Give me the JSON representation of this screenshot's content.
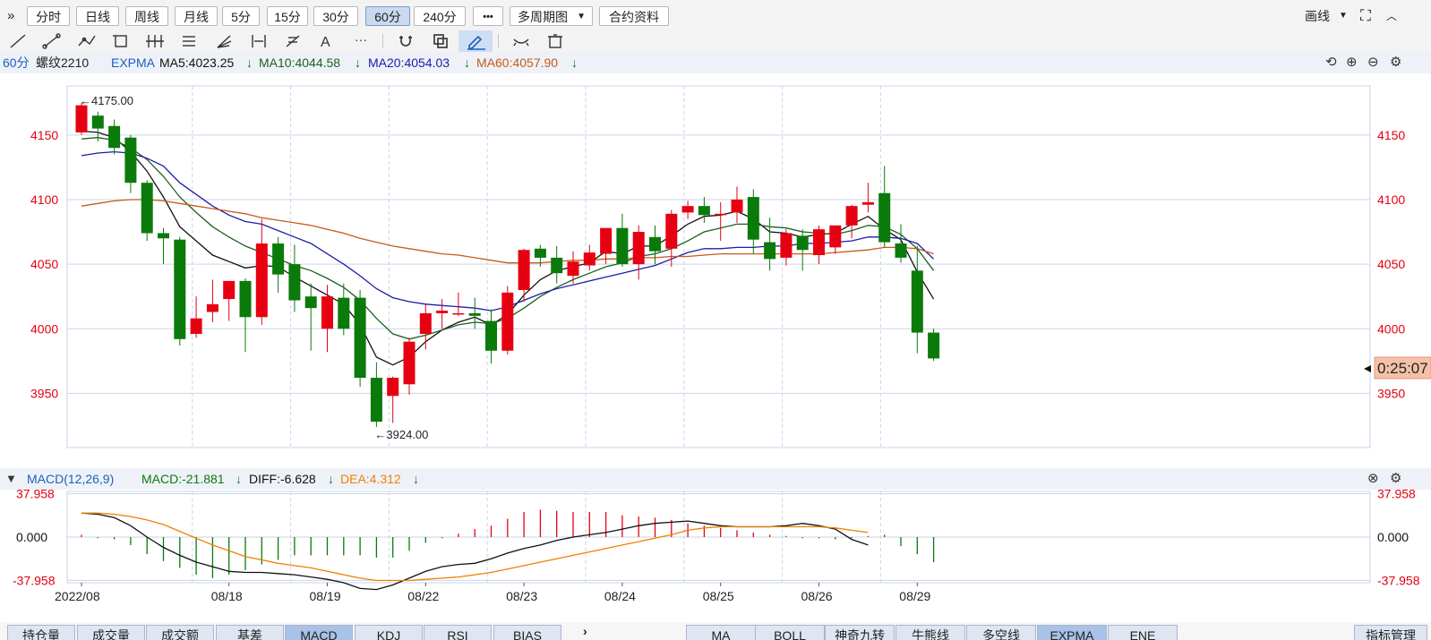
{
  "toolbar": {
    "expand_glyph": "»",
    "periods": [
      {
        "label": "分时",
        "active": false
      },
      {
        "label": "日线",
        "active": false
      },
      {
        "label": "周线",
        "active": false
      },
      {
        "label": "月线",
        "active": false
      },
      {
        "label": "5分",
        "active": false
      },
      {
        "label": "15分",
        "active": false
      },
      {
        "label": "30分",
        "active": false
      },
      {
        "label": "60分",
        "active": true
      },
      {
        "label": "240分",
        "active": false
      }
    ],
    "more": "•••",
    "multi_period": "多周期图",
    "contract_info": "合约资料",
    "draw": "画线",
    "fullscreen_glyph": "⛶"
  },
  "drawing_tools": [
    "line-icon",
    "ray-icon",
    "polyline-icon",
    "rectangle-tool-icon",
    "parallel-channel-icon",
    "fibonacci-icon",
    "fan-icon",
    "measure-icon",
    "gann-icon",
    "text-tool-icon",
    "more-tools-icon",
    "magnet-icon",
    "copy-icon",
    "pencil-icon",
    "hide-icon",
    "trash-icon"
  ],
  "info": {
    "period": "60分",
    "symbol": "螺纹2210",
    "indicator": "EXPMA",
    "ma5": "MA5:4023.25",
    "ma10": "MA10:4044.58",
    "ma20": "MA20:4054.03",
    "ma60": "MA60:4057.90",
    "down_arrow": "↓"
  },
  "macd_info": {
    "name": "MACD(12,26,9)",
    "macd": "MACD:-21.881",
    "diff": "DIFF:-6.628",
    "dea": "DEA:4.312",
    "down_arrow": "↓"
  },
  "countdown": "0:25:07",
  "bottom_tabs_left": [
    {
      "label": "持仓量",
      "active": false
    },
    {
      "label": "成交量",
      "active": false
    },
    {
      "label": "成交额",
      "active": false
    },
    {
      "label": "基差",
      "active": false
    },
    {
      "label": "MACD",
      "active": true
    },
    {
      "label": "KDJ",
      "active": false
    },
    {
      "label": "RSI",
      "active": false
    },
    {
      "label": "BIAS",
      "active": false
    }
  ],
  "bottom_tabs_right": [
    {
      "label": "MA",
      "active": false
    },
    {
      "label": "BOLL",
      "active": false
    },
    {
      "label": "神奇九转",
      "active": false
    },
    {
      "label": "牛熊线",
      "active": false
    },
    {
      "label": "多空线",
      "active": false
    },
    {
      "label": "EXPMA",
      "active": true
    },
    {
      "label": "ENE",
      "active": false
    }
  ],
  "indicator_manage": "指标管理",
  "colors": {
    "up": "#e60012",
    "down": "#0a7a0a",
    "ma5": "#111111",
    "ma10": "#1f5f1f",
    "ma20": "#1c1ca8",
    "ma60": "#c85a1a",
    "dea": "#f08000",
    "axis_red": "#e60012",
    "grid": "#c9d6ea"
  },
  "chart_data": [
    {
      "type": "candlestick",
      "ylim": [
        3908,
        4188
      ],
      "yticks": [
        4150,
        4100,
        4050,
        4000,
        3950
      ],
      "ytick_labels": [
        "4150",
        "4100",
        "4050",
        "4000",
        "3950"
      ],
      "annotations": [
        {
          "text": "←4175.00",
          "value": 4175,
          "bar": 0
        },
        {
          "text": "←3924.00",
          "value": 3924,
          "bar": 18
        }
      ],
      "x_labels": [
        {
          "text": "2022/08",
          "bar": 0
        },
        {
          "text": "08/18",
          "bar": 9
        },
        {
          "text": "08/19",
          "bar": 15
        },
        {
          "text": "08/22",
          "bar": 21
        },
        {
          "text": "08/23",
          "bar": 27
        },
        {
          "text": "08/24",
          "bar": 33
        },
        {
          "text": "08/25",
          "bar": 39
        },
        {
          "text": "08/26",
          "bar": 45
        },
        {
          "text": "08/29",
          "bar": 51
        }
      ],
      "ohlc": [
        [
          4152,
          4175,
          4150,
          4173
        ],
        [
          4165,
          4168,
          4145,
          4155
        ],
        [
          4157,
          4162,
          4135,
          4140
        ],
        [
          4148,
          4150,
          4105,
          4113
        ],
        [
          4113,
          4115,
          4068,
          4074
        ],
        [
          4074,
          4078,
          4050,
          4070
        ],
        [
          4069,
          4071,
          3987,
          3992
        ],
        [
          3996,
          4025,
          3993,
          4008
        ],
        [
          4013,
          4038,
          4005,
          4019
        ],
        [
          4023,
          4035,
          4006,
          4037
        ],
        [
          4037,
          4039,
          3982,
          4009
        ],
        [
          4009,
          4085,
          4003,
          4066
        ],
        [
          4066,
          4071,
          4028,
          4042
        ],
        [
          4050,
          4065,
          4013,
          4022
        ],
        [
          4025,
          4035,
          3983,
          4016
        ],
        [
          4000,
          4034,
          3982,
          4025
        ],
        [
          4024,
          4035,
          3995,
          4000
        ],
        [
          4024,
          4030,
          3955,
          3962
        ],
        [
          3962,
          3974,
          3924,
          3928
        ],
        [
          3948,
          3963,
          3927,
          3962
        ],
        [
          3957,
          3993,
          3949,
          3990
        ],
        [
          3996,
          4019,
          3984,
          4012
        ],
        [
          4012,
          4023,
          4000,
          4014
        ],
        [
          4012,
          4028,
          4010,
          4012
        ],
        [
          4012,
          4024,
          4000,
          4010
        ],
        [
          4006,
          4015,
          3973,
          3983
        ],
        [
          3983,
          4033,
          3980,
          4028
        ],
        [
          4030,
          4062,
          4021,
          4061
        ],
        [
          4062,
          4065,
          4048,
          4055
        ],
        [
          4055,
          4064,
          4035,
          4043
        ],
        [
          4041,
          4060,
          4035,
          4052
        ],
        [
          4049,
          4065,
          4045,
          4059
        ],
        [
          4058,
          4072,
          4050,
          4078
        ],
        [
          4078,
          4089,
          4048,
          4050
        ],
        [
          4050,
          4080,
          4038,
          4075
        ],
        [
          4071,
          4080,
          4050,
          4060
        ],
        [
          4062,
          4092,
          4048,
          4089
        ],
        [
          4090,
          4099,
          4085,
          4095
        ],
        [
          4095,
          4102,
          4082,
          4088
        ],
        [
          4089,
          4098,
          4068,
          4089
        ],
        [
          4090,
          4110,
          4082,
          4100
        ],
        [
          4102,
          4108,
          4058,
          4069
        ],
        [
          4067,
          4086,
          4045,
          4054
        ],
        [
          4055,
          4077,
          4049,
          4074
        ],
        [
          4072,
          4077,
          4045,
          4061
        ],
        [
          4057,
          4080,
          4050,
          4077
        ],
        [
          4063,
          4072,
          4058,
          4080
        ],
        [
          4080,
          4096,
          4070,
          4095
        ],
        [
          4096,
          4113,
          4090,
          4098
        ],
        [
          4105,
          4126,
          4063,
          4067
        ],
        [
          4066,
          4081,
          4051,
          4055
        ],
        [
          4045,
          4064,
          3981,
          3997
        ],
        [
          3997,
          4000,
          3975,
          3977
        ]
      ],
      "series": [
        {
          "name": "MA5",
          "values": [
            4153,
            4152,
            4148,
            4137,
            4122,
            4102,
            4079,
            4068,
            4057,
            4052,
            4047,
            4049,
            4048,
            4040,
            4033,
            4026,
            4019,
            4003,
            3978,
            3972,
            3978,
            3990,
            3999,
            4005,
            4009,
            4003,
            4011,
            4026,
            4038,
            4045,
            4048,
            4051,
            4060,
            4058,
            4064,
            4064,
            4072,
            4081,
            4087,
            4088,
            4091,
            4085,
            4075,
            4074,
            4071,
            4073,
            4074,
            4081,
            4087,
            4077,
            4069,
            4044,
            4023
          ]
        },
        {
          "name": "MA10",
          "values": [
            4147,
            4148,
            4146,
            4140,
            4131,
            4118,
            4102,
            4090,
            4079,
            4071,
            4064,
            4059,
            4054,
            4049,
            4045,
            4039,
            4032,
            4022,
            4008,
            3996,
            3992,
            3995,
            3999,
            4003,
            4005,
            4004,
            4008,
            4016,
            4025,
            4032,
            4038,
            4043,
            4048,
            4051,
            4056,
            4058,
            4062,
            4068,
            4075,
            4078,
            4081,
            4081,
            4079,
            4078,
            4075,
            4074,
            4073,
            4076,
            4080,
            4079,
            4073,
            4062,
            4045
          ]
        },
        {
          "name": "MA20",
          "values": [
            4134,
            4136,
            4137,
            4136,
            4132,
            4126,
            4113,
            4104,
            4095,
            4088,
            4083,
            4081,
            4076,
            4071,
            4066,
            4058,
            4050,
            4041,
            4031,
            4024,
            4021,
            4019,
            4018,
            4017,
            4016,
            4014,
            4017,
            4022,
            4027,
            4031,
            4034,
            4037,
            4040,
            4043,
            4046,
            4049,
            4054,
            4059,
            4062,
            4062,
            4063,
            4063,
            4064,
            4064,
            4066,
            4066,
            4067,
            4068,
            4071,
            4071,
            4070,
            4066,
            4054
          ]
        },
        {
          "name": "MA60",
          "values": [
            4095,
            4097,
            4099,
            4100,
            4100,
            4099,
            4097,
            4095,
            4093,
            4091,
            4089,
            4086,
            4084,
            4082,
            4080,
            4077,
            4074,
            4070,
            4067,
            4064,
            4062,
            4060,
            4058,
            4057,
            4055,
            4053,
            4051,
            4051,
            4051,
            4052,
            4053,
            4053,
            4054,
            4054,
            4055,
            4055,
            4056,
            4056,
            4057,
            4058,
            4058,
            4058,
            4058,
            4058,
            4058,
            4058,
            4059,
            4060,
            4061,
            4063,
            4063,
            4062,
            4058
          ]
        }
      ]
    },
    {
      "type": "macd",
      "ylim": [
        -40,
        40
      ],
      "yticks": [
        37.958,
        0,
        -37.958
      ],
      "ytick_labels": [
        "37.958",
        "0.000",
        "-37.958"
      ],
      "histogram": [
        2,
        -1,
        -2,
        -7,
        -15,
        -21,
        -27,
        -33,
        -36,
        -33,
        -29,
        -24,
        -20,
        -16,
        -16,
        -16,
        -16,
        -16,
        -18,
        -18,
        -12,
        -5,
        -1,
        3,
        7,
        10,
        16,
        22,
        24,
        23,
        22,
        22,
        22,
        19,
        18,
        17,
        15,
        12,
        10,
        8,
        6,
        4,
        2,
        1,
        -1,
        -1,
        -2,
        -1,
        1,
        2,
        -8,
        -15,
        -22
      ],
      "series": [
        {
          "name": "DIFF",
          "values": [
            21,
            20,
            17,
            10,
            0,
            -9,
            -16,
            -22,
            -26,
            -30,
            -31,
            -31,
            -32,
            -33,
            -35,
            -37,
            -40,
            -45,
            -46,
            -42,
            -36,
            -30,
            -26,
            -24,
            -23,
            -19,
            -14,
            -10,
            -7,
            -3,
            0,
            2,
            4,
            7,
            10,
            12,
            13,
            14,
            12,
            10,
            9,
            9,
            9,
            10,
            12,
            10,
            7,
            -2,
            -7
          ]
        },
        {
          "name": "DEA",
          "values": [
            21,
            21,
            20,
            18,
            15,
            11,
            5,
            -1,
            -7,
            -12,
            -17,
            -20,
            -23,
            -25,
            -27,
            -30,
            -33,
            -36,
            -38,
            -38,
            -38,
            -37,
            -36,
            -35,
            -33,
            -31,
            -28,
            -25,
            -22,
            -19,
            -16,
            -13,
            -10,
            -7,
            -4,
            -1,
            2,
            6,
            8,
            9,
            9,
            9,
            9,
            9,
            9,
            9,
            8,
            6,
            4
          ]
        }
      ]
    }
  ]
}
